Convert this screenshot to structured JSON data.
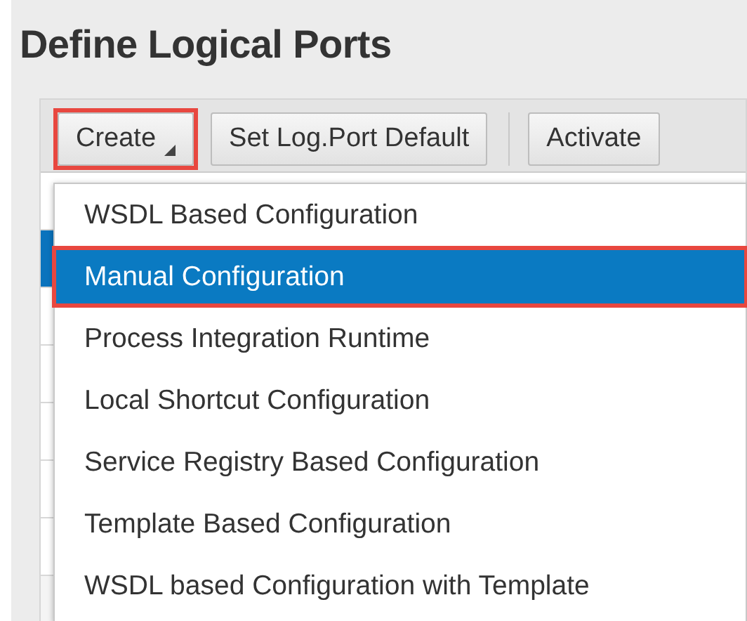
{
  "page": {
    "title": "Define Logical Ports"
  },
  "toolbar": {
    "buttons": [
      {
        "label": "Create",
        "kind": "menu",
        "highlighted": true
      },
      {
        "label": "Set Log.Port Default",
        "kind": "plain",
        "highlighted": false
      },
      {
        "label": "Activate",
        "kind": "plain",
        "highlighted": false
      }
    ]
  },
  "table": {
    "rows": [
      {
        "selected": false
      },
      {
        "selected": true
      },
      {
        "selected": false
      },
      {
        "selected": false
      },
      {
        "selected": false
      },
      {
        "selected": false
      },
      {
        "selected": false
      }
    ]
  },
  "menu": {
    "items": [
      {
        "label": "WSDL Based Configuration",
        "selected": false,
        "highlighted": false
      },
      {
        "label": "Manual Configuration",
        "selected": true,
        "highlighted": true
      },
      {
        "label": "Process Integration Runtime",
        "selected": false,
        "highlighted": false
      },
      {
        "label": "Local Shortcut Configuration",
        "selected": false,
        "highlighted": false
      },
      {
        "label": "Service Registry Based Configuration",
        "selected": false,
        "highlighted": false
      },
      {
        "label": "Template Based Configuration",
        "selected": false,
        "highlighted": false
      },
      {
        "label": "WSDL based Configuration with Template",
        "selected": false,
        "highlighted": false
      }
    ]
  }
}
